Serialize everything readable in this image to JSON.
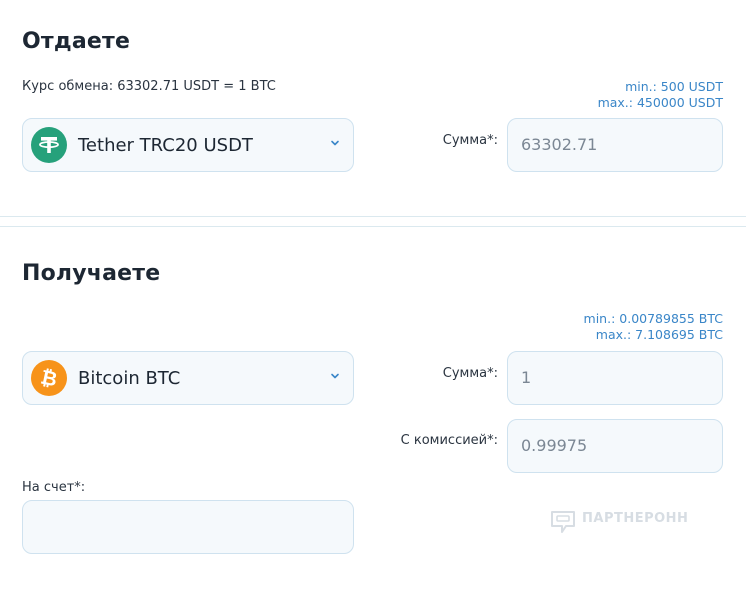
{
  "give": {
    "title": "Отдаете",
    "rate": "Курс обмена: 63302.71 USDT = 1 BTC",
    "min": "min.: 500 USDT",
    "max": "max.: 450000 USDT",
    "currency": {
      "name": "Tether TRC20 USDT",
      "icon": "tether-icon",
      "color": "#26a17b"
    },
    "sum_label": "Сумма*:",
    "sum_value": "63302.71"
  },
  "receive": {
    "title": "Получаете",
    "min": "min.: 0.00789855 BTC",
    "max": "max.: 7.108695 BTC",
    "currency": {
      "name": "Bitcoin BTC",
      "icon": "bitcoin-icon",
      "color": "#f7931a"
    },
    "sum_label": "Сумма*:",
    "sum_value": "1",
    "commission_label": "С комиссией*:",
    "commission_value": "0.99975",
    "account_label": "На счет*:",
    "account_value": ""
  },
  "watermark": {
    "text": "ПАРТНЕРОНН"
  },
  "colors": {
    "accent": "#3a86c8",
    "border": "#cfe2ef",
    "field_bg": "#f5f9fc"
  }
}
